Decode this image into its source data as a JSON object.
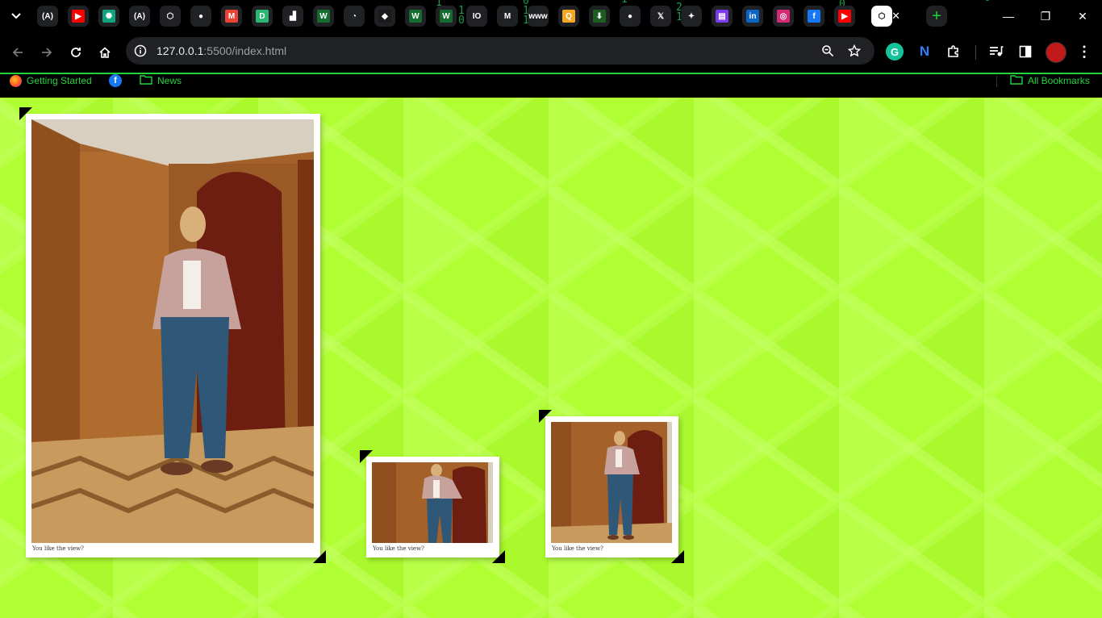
{
  "browser": {
    "tabs": [
      {
        "icon": "vercel-v0-icon",
        "glyph": "(A)"
      },
      {
        "icon": "youtube-icon",
        "glyph": "▶"
      },
      {
        "icon": "chatgpt-icon",
        "glyph": "✺"
      },
      {
        "icon": "vercel-v0-icon",
        "glyph": "(A)"
      },
      {
        "icon": "codepen-icon",
        "glyph": "⬡"
      },
      {
        "icon": "github-icon",
        "glyph": "●"
      },
      {
        "icon": "gmail-icon",
        "glyph": "M"
      },
      {
        "icon": "dev-doc-icon",
        "glyph": "D"
      },
      {
        "icon": "dark-app-icon",
        "glyph": "▟"
      },
      {
        "icon": "webflow-icon",
        "glyph": "W"
      },
      {
        "icon": "gauge-icon",
        "glyph": "◔"
      },
      {
        "icon": "cube-icon",
        "glyph": "◆"
      },
      {
        "icon": "webflow-icon",
        "glyph": "W"
      },
      {
        "icon": "webflow-icon",
        "glyph": "W"
      },
      {
        "icon": "io-icon",
        "glyph": "IO"
      },
      {
        "icon": "m-icon",
        "glyph": "M"
      },
      {
        "icon": "www-icon",
        "glyph": "www"
      },
      {
        "icon": "search-orange-icon",
        "glyph": "Q"
      },
      {
        "icon": "download-arrow-icon",
        "glyph": "⬇"
      },
      {
        "icon": "github-icon",
        "glyph": "●"
      },
      {
        "icon": "x-icon",
        "glyph": "𝕏"
      },
      {
        "icon": "gemini-icon",
        "glyph": "✦"
      },
      {
        "icon": "clapper-icon",
        "glyph": "▤"
      },
      {
        "icon": "linkedin-icon",
        "glyph": "in"
      },
      {
        "icon": "instagram-icon",
        "glyph": "◎"
      },
      {
        "icon": "facebook-icon",
        "glyph": "f"
      },
      {
        "icon": "youtube-icon",
        "glyph": "▶"
      },
      {
        "icon": "codepen-icon",
        "glyph": "⬡",
        "active": true
      }
    ],
    "tab_close_glyph": "✕",
    "new_tab_glyph": "+",
    "address": {
      "host": "127.0.0.1",
      "rest": ":5500/index.html"
    },
    "bookmarks": [
      {
        "label": "Getting Started",
        "icon": "firefox-icon"
      },
      {
        "label": "",
        "icon": "facebook-icon"
      },
      {
        "label": "News",
        "icon": "folder-icon"
      }
    ],
    "all_bookmarks": "All Bookmarks"
  },
  "gallery": {
    "colors": {
      "background": "#b0ff33",
      "frame": "#ffffff",
      "corner": "#000000"
    },
    "cards": [
      {
        "caption": "You like the view?",
        "size": "large"
      },
      {
        "caption": "You like the view?",
        "size": "small"
      },
      {
        "caption": "You like the view?",
        "size": "medium"
      }
    ]
  }
}
